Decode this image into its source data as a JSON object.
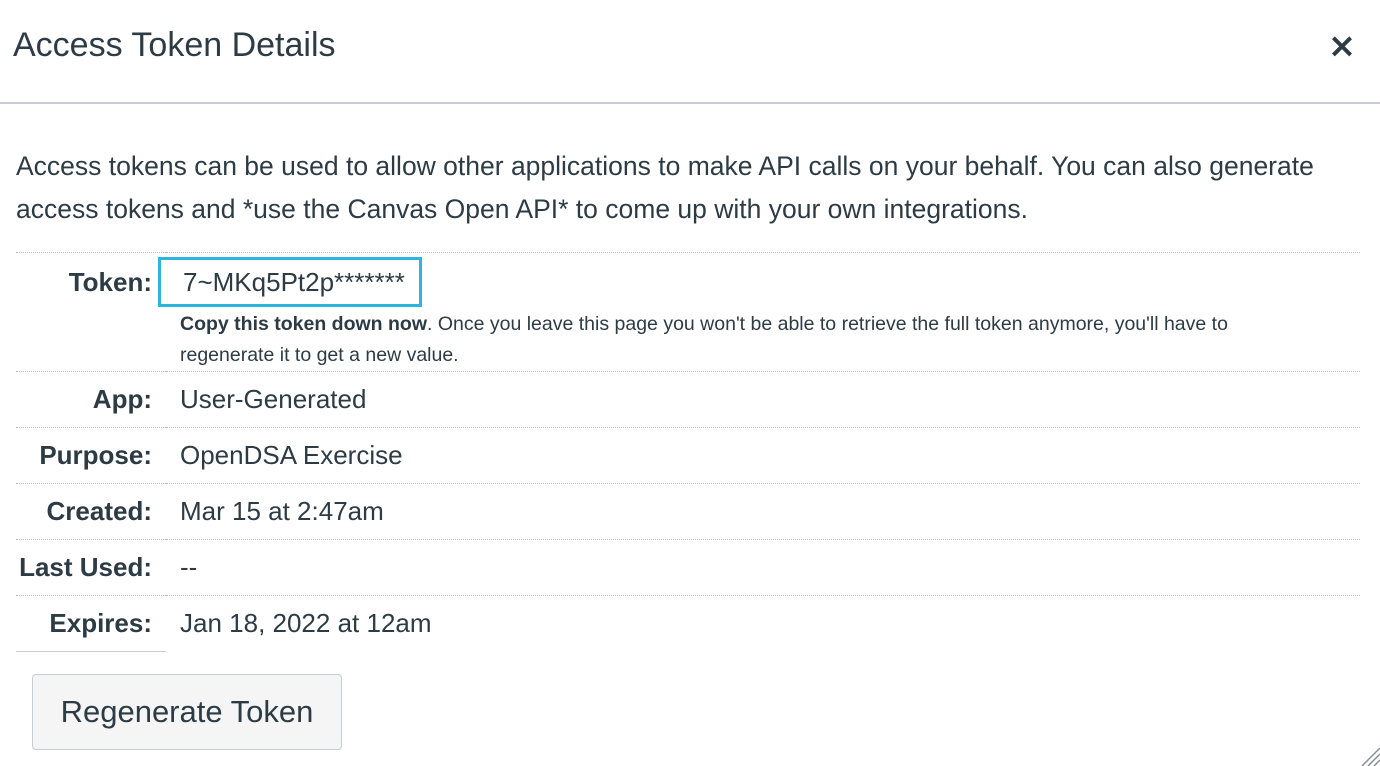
{
  "dialog": {
    "title": "Access Token Details",
    "close_label": "×"
  },
  "intro": {
    "text": "Access tokens can be used to allow other applications to make API calls on your behalf. You can also generate access tokens and *use the Canvas Open API* to come up with your own integrations."
  },
  "details": {
    "token": {
      "label": "Token:",
      "value": "7~MKq5Pt2p*******",
      "note_bold": "Copy this token down now",
      "note_rest": ". Once you leave this page you won't be able to retrieve the full token anymore, you'll have to regenerate it to get a new value."
    },
    "app": {
      "label": "App:",
      "value": "User-Generated"
    },
    "purpose": {
      "label": "Purpose:",
      "value": "OpenDSA Exercise"
    },
    "created": {
      "label": "Created:",
      "value": "Mar 15 at 2:47am"
    },
    "last_used": {
      "label": "Last Used:",
      "value": "--"
    },
    "expires": {
      "label": "Expires:",
      "value": "Jan 18, 2022 at 12am"
    }
  },
  "actions": {
    "regenerate_label": "Regenerate Token"
  },
  "colors": {
    "highlight": "#2bb5e0",
    "text": "#2d3b45",
    "border": "#c7cdd1"
  }
}
